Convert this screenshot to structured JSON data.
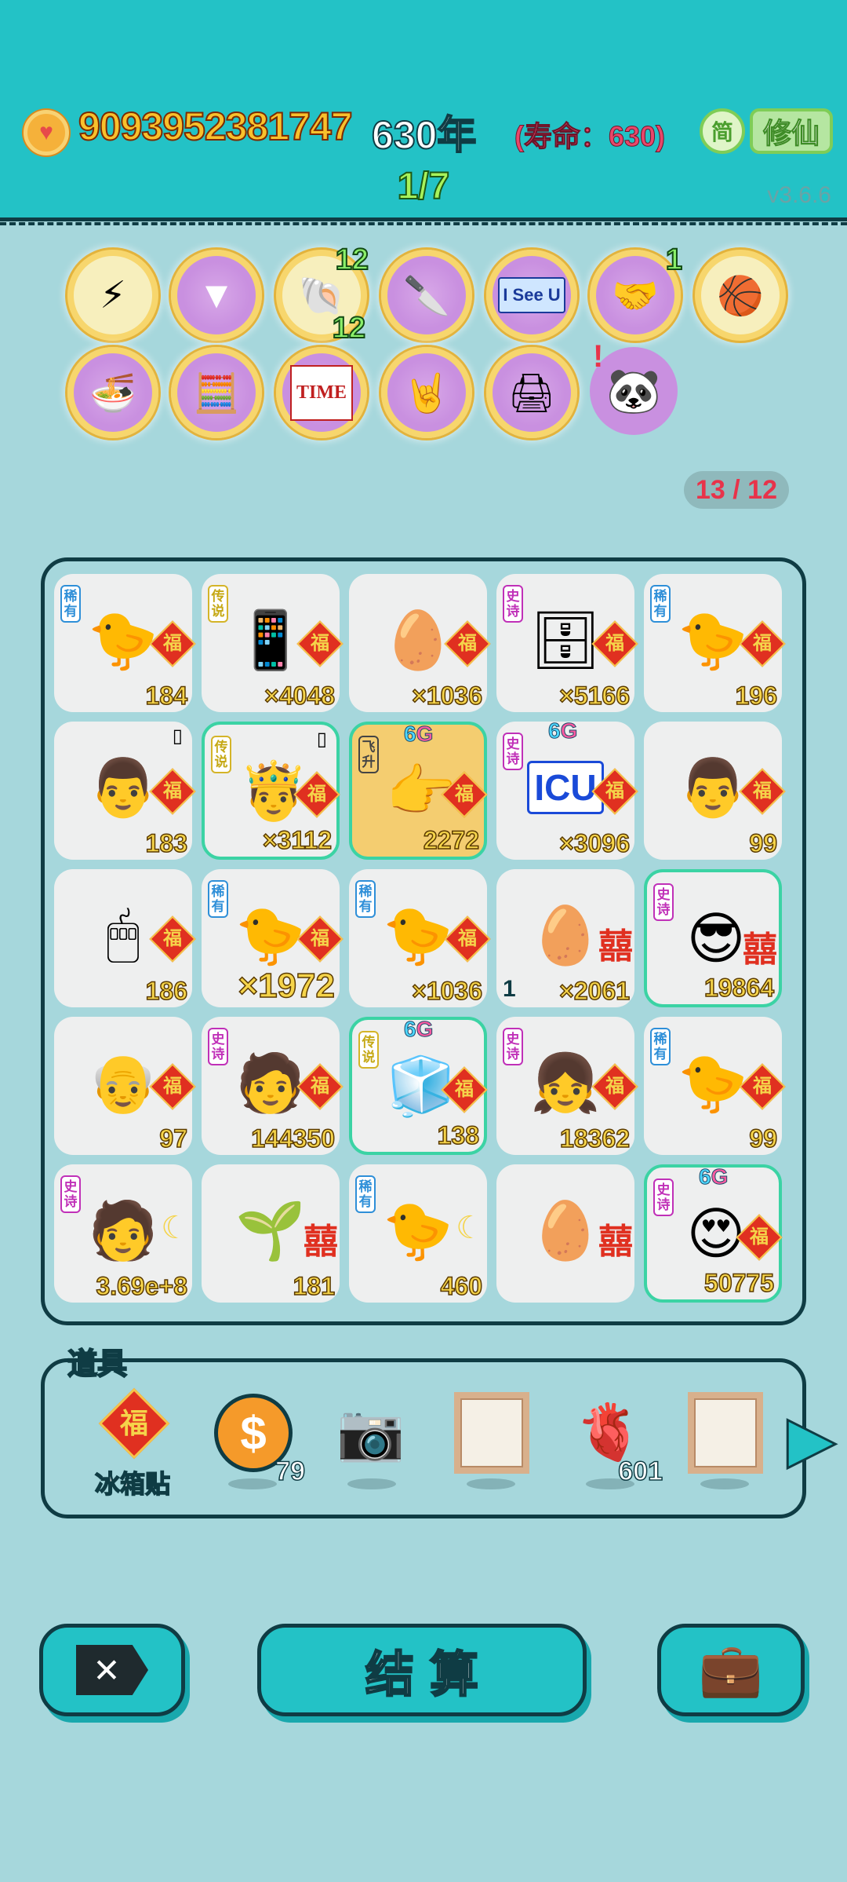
{
  "header": {
    "money": "9093952381747",
    "years": "630年",
    "lifespan": "(寿命：630)",
    "simplified_label": "简",
    "mode_label": "修仙",
    "page_indicator": "1/7",
    "version": "v3.6.6"
  },
  "skills": {
    "row1": [
      {
        "icon": "lightning-icon",
        "glyph": "⚡"
      },
      {
        "icon": "skirt-icon",
        "glyph": "▼"
      },
      {
        "icon": "shell-icon",
        "glyph": "🐚",
        "badge_top": "12",
        "badge_bottom": "12"
      },
      {
        "icon": "cleaver-icon",
        "glyph": "🔪"
      },
      {
        "icon": "i-see-u-icon",
        "text": "I See U"
      },
      {
        "icon": "handshake-icon",
        "glyph": "🤝",
        "badge_top": "1"
      },
      {
        "icon": "basketballs-icon",
        "glyph": "🏀"
      }
    ],
    "row2": [
      {
        "icon": "fortune-bowl-icon",
        "glyph": "🍜"
      },
      {
        "icon": "math-head-icon",
        "glyph": "🧮"
      },
      {
        "icon": "time-magazine-icon",
        "text": "TIME"
      },
      {
        "icon": "rock-hand-icon",
        "glyph": "🤘"
      },
      {
        "icon": "printer-icon",
        "glyph": "🖨"
      },
      {
        "icon": "panda-icon",
        "glyph": "🐼",
        "alert": "!"
      }
    ]
  },
  "counter": "13 / 12",
  "grid": [
    {
      "tag": "稀有",
      "tag_class": "r",
      "icon": "chick-icon",
      "glyph": "🐤",
      "badge": "福",
      "count": "184"
    },
    {
      "tag": "传说",
      "tag_class": "l",
      "icon": "smartphone-icon",
      "glyph": "📱",
      "badge": "福",
      "count": "×4048"
    },
    {
      "tag": "",
      "tag_class": "",
      "icon": "egg-plus-icon",
      "glyph": "🥚",
      "badge": "福",
      "count": "×1036"
    },
    {
      "tag": "史诗",
      "tag_class": "e",
      "icon": "server-icon",
      "glyph": "🗄",
      "badge": "福",
      "count": "×5166"
    },
    {
      "tag": "稀有",
      "tag_class": "r",
      "icon": "chick-icon",
      "glyph": "🐤",
      "badge": "福",
      "count": "196"
    },
    {
      "tag": "",
      "tag_class": "",
      "icon": "man-face-icon",
      "glyph": "👨",
      "badge": "福",
      "count": "183",
      "phone": "▯"
    },
    {
      "tag": "传说",
      "tag_class": "l",
      "icon": "king-face-icon",
      "glyph": "🤴",
      "badge": "福",
      "count": "×3112",
      "phone": "▯",
      "style": "hl"
    },
    {
      "tag": "飞升",
      "tag_class": "f",
      "icon": "pointing-hand-icon",
      "glyph": "👉",
      "badge": "福",
      "count": "2272",
      "sixg": true,
      "style": "gold"
    },
    {
      "tag": "史诗",
      "tag_class": "e",
      "icon": "icu-sign-icon",
      "text": "ICU",
      "badge": "福",
      "count": "×3096",
      "sixg": true
    },
    {
      "tag": "",
      "tag_class": "",
      "icon": "man-face-icon",
      "glyph": "👨",
      "badge": "福",
      "count": "99"
    },
    {
      "tag": "",
      "tag_class": "",
      "icon": "mouse-icon",
      "glyph": "🖱",
      "badge": "福",
      "count": "186"
    },
    {
      "tag": "稀有",
      "tag_class": "r",
      "icon": "chick-icon",
      "glyph": "🐤",
      "badge": "福",
      "count": "×1972",
      "big": true
    },
    {
      "tag": "稀有",
      "tag_class": "r",
      "icon": "chick-icon",
      "glyph": "🐤",
      "badge": "福",
      "count": "×1036"
    },
    {
      "tag": "",
      "tag_class": "",
      "icon": "egg-face-icon",
      "glyph": "🥚",
      "badge": "囍",
      "count": "×2061",
      "left": "1"
    },
    {
      "tag": "史诗",
      "tag_class": "e",
      "icon": "cap-face-icon",
      "glyph": "😎",
      "badge": "囍",
      "count": "19864",
      "style": "hl"
    },
    {
      "tag": "",
      "tag_class": "",
      "icon": "old-man-face-icon",
      "glyph": "👴",
      "badge": "福",
      "count": "97"
    },
    {
      "tag": "史诗",
      "tag_class": "e",
      "icon": "green-hair-face-icon",
      "glyph": "🧑",
      "badge": "福",
      "count": "144350"
    },
    {
      "tag": "传说",
      "tag_class": "l",
      "icon": "fridge-icon",
      "glyph": "🧊",
      "badge": "福",
      "count": "138",
      "sixg": true,
      "style": "hl"
    },
    {
      "tag": "史诗",
      "tag_class": "e",
      "icon": "girl-face-icon",
      "glyph": "👧",
      "badge": "福",
      "count": "18362"
    },
    {
      "tag": "稀有",
      "tag_class": "r",
      "icon": "chick-icon",
      "glyph": "🐤",
      "badge": "福",
      "count": "99"
    },
    {
      "tag": "史诗",
      "tag_class": "e",
      "icon": "green-hair-face-icon",
      "glyph": "🧑",
      "badge": "moon",
      "count": "3.69e+8"
    },
    {
      "tag": "",
      "tag_class": "",
      "icon": "sprout-icon",
      "glyph": "🌱",
      "badge": "囍",
      "count": "181"
    },
    {
      "tag": "稀有",
      "tag_class": "r",
      "icon": "chick-icon",
      "glyph": "🐤",
      "badge": "moon",
      "count": "460"
    },
    {
      "tag": "",
      "tag_class": "",
      "icon": "egg-plus-icon",
      "glyph": "🥚",
      "badge": "囍",
      "count": ""
    },
    {
      "tag": "史诗",
      "tag_class": "e",
      "icon": "heart-eyes-icon",
      "glyph": "😍",
      "badge": "福",
      "count": "50775",
      "sixg": true,
      "style": "hl"
    }
  ],
  "items": {
    "title": "道具",
    "list": [
      {
        "icon": "fu-sticker-icon",
        "label": "冰箱贴",
        "count": ""
      },
      {
        "icon": "coin-icon",
        "label": "",
        "count": "79"
      },
      {
        "icon": "camera-icon",
        "label": "",
        "count": ""
      },
      {
        "icon": "frame-icon",
        "label": "",
        "count": ""
      },
      {
        "icon": "liver-icon",
        "label": "",
        "count": "601"
      },
      {
        "icon": "frame-icon",
        "label": "",
        "count": ""
      }
    ]
  },
  "buttons": {
    "exit": "✕",
    "settle": "结算",
    "bag": "briefcase-icon"
  },
  "colors": {
    "header_bg": "#23c2c6",
    "page_bg": "#a6d7dc",
    "outline": "#0f3c44",
    "gold_number": "#f5d44a",
    "red_badge": "#e03020"
  }
}
